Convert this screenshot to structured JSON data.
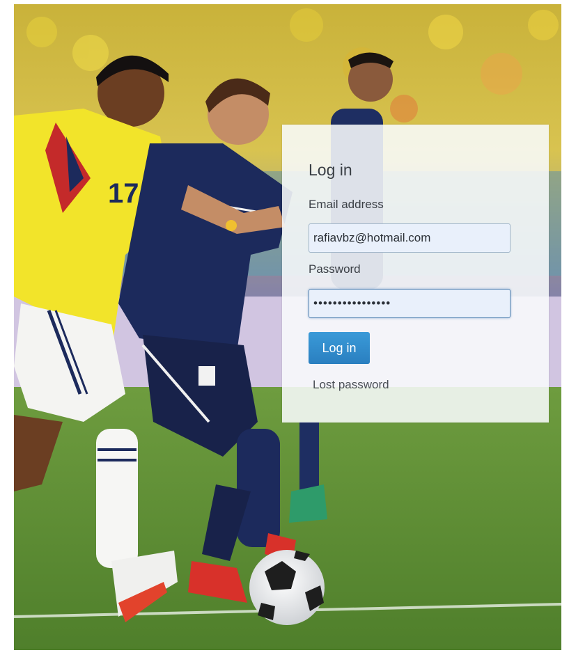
{
  "login": {
    "title": "Log in",
    "email_label": "Email address",
    "email_value": "rafiavbz@hotmail.com",
    "password_label": "Password",
    "password_value": "••••••••••••••••",
    "submit_label": "Log in",
    "lost_password_label": "Lost password"
  },
  "photo": {
    "jersey_number": "17"
  },
  "colors": {
    "button": "#2a8ad0",
    "input_bg": "#e9f0fb",
    "pitch": "#5f8f35",
    "jersey_yellow": "#f2e42a",
    "jersey_navy": "#1c2a5c"
  }
}
